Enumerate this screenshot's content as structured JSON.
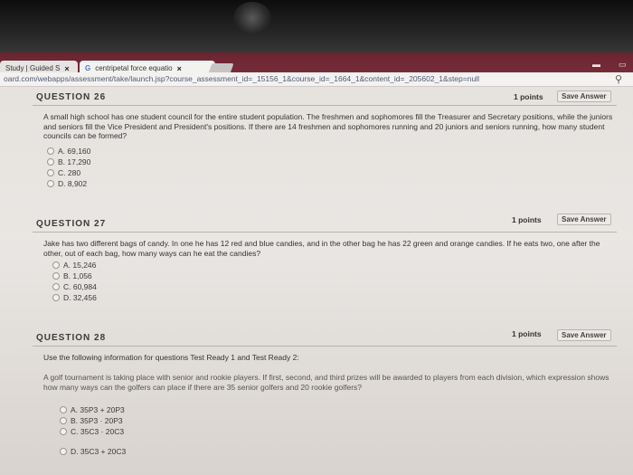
{
  "browser": {
    "tabs": [
      {
        "label": "Study | Guided S",
        "close": "×"
      },
      {
        "label": "centripetal force equatio",
        "close": "×"
      }
    ],
    "url": "oard.com/webapps/assessment/take/launch.jsp?course_assessment_id=_15156_1&course_id=_1664_1&content_id=_205602_1&step=null"
  },
  "questions": [
    {
      "title": "QUESTION 26",
      "points": "1 points",
      "save": "Save Answer",
      "text": "A small high school has one student council for the entire student population. The freshmen and sophomores fill the Treasurer and Secretary positions, while the juniors and seniors fill the Vice President and President's positions. If there are 14 freshmen and sophomores running and 20 juniors and seniors running, how many student councils can be formed?",
      "options": [
        "A. 69,160",
        "B. 17,290",
        "C. 280",
        "D. 8,902"
      ]
    },
    {
      "title": "QUESTION 27",
      "points": "1 points",
      "save": "Save Answer",
      "text": "Jake has two different bags of candy. In one he has 12 red and blue candies, and in the other bag he has 22 green and orange candies. If he eats two, one after the other, out of each bag, how many ways can he eat the candies?",
      "options": [
        "A. 15,246",
        "B. 1,056",
        "C. 60,984",
        "D. 32,456"
      ]
    },
    {
      "title": "QUESTION 28",
      "points": "1 points",
      "save": "Save Answer",
      "intro": "Use the following information for questions Test Ready 1 and Test Ready 2:",
      "text": "A golf tournament is taking place with senior and rookie players. If first, second, and third prizes will be awarded to players from each division, which expression shows how many ways can the golfers can place if there are 35 senior golfers and 20 rookie golfers?",
      "options": [
        "A. 35P3 + 20P3",
        "B. 35P3 · 20P3",
        "C. 35C3 · 20C3",
        "D. 35C3 + 20C3"
      ]
    }
  ],
  "colors": {
    "chrome": "#7d3140",
    "page": "#e8e5e2"
  }
}
